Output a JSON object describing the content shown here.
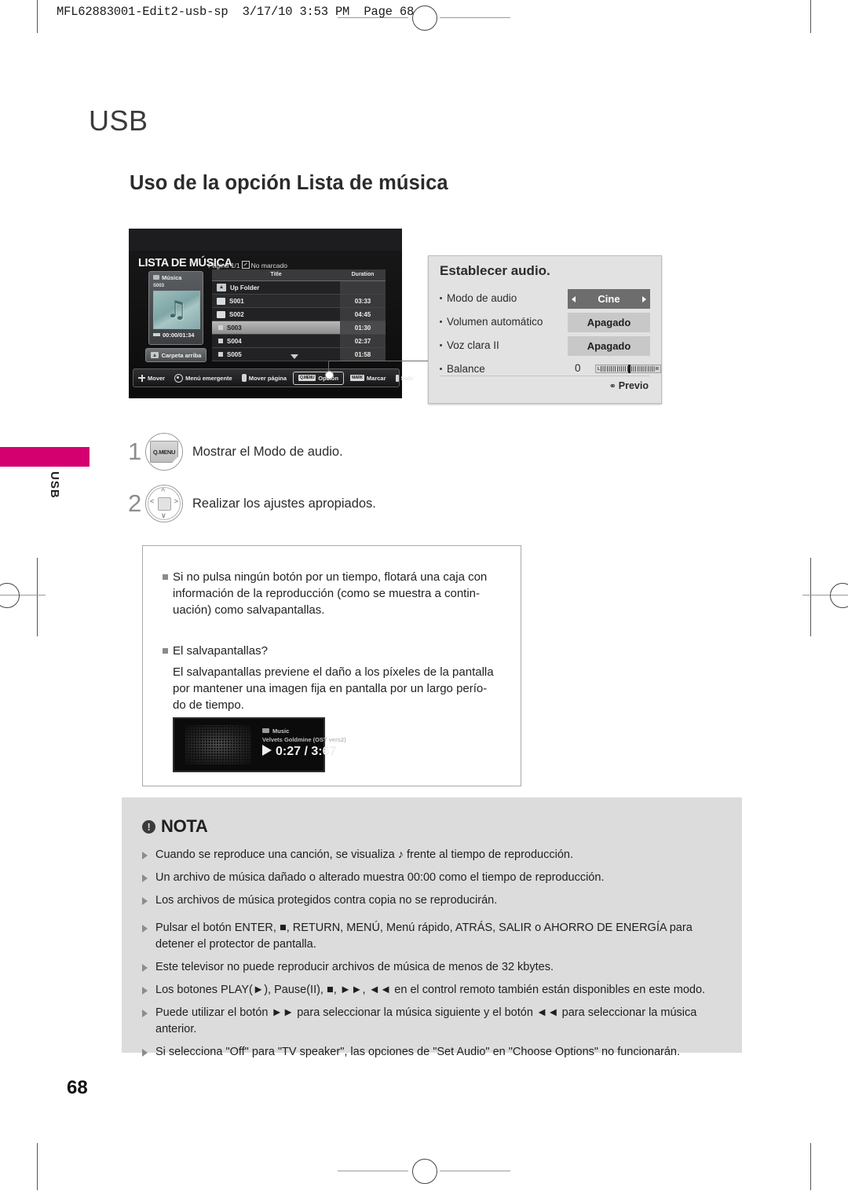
{
  "print_header": "MFL62883001-Edit2-usb-sp  3/17/10 3:53 PM  Page 68",
  "page_number": "68",
  "side_tab_label": "USB",
  "chapter_title": "USB",
  "section_title": "Uso de la opción Lista de música",
  "music_list_screen": {
    "title": "LISTA DE MÚSICA",
    "page_indicator": "Página 1/1",
    "mark_status": "No marcado",
    "preview": {
      "header": "Música",
      "file": "S003",
      "time": "00:00/01:34",
      "up_button": "Carpeta arriba"
    },
    "columns": {
      "title": "Title",
      "duration": "Duration"
    },
    "rows": [
      {
        "name": "Up Folder",
        "duration": "",
        "icon": "up-folder-icon",
        "selected": false
      },
      {
        "name": "S001",
        "duration": "03:33",
        "icon": "folder-icon",
        "selected": false
      },
      {
        "name": "S002",
        "duration": "04:45",
        "icon": "folder-icon",
        "selected": false
      },
      {
        "name": "S003",
        "duration": "01:30",
        "icon": "music-file-icon",
        "selected": true
      },
      {
        "name": "S004",
        "duration": "02:37",
        "icon": "music-file-icon",
        "selected": false
      },
      {
        "name": "S005",
        "duration": "01:58",
        "icon": "music-file-icon",
        "selected": false
      }
    ],
    "toolbar": [
      {
        "label": "Mover",
        "key": "",
        "icon": "dpad-icon"
      },
      {
        "label": "Menú emergente",
        "key": "",
        "icon": "wheel-icon"
      },
      {
        "label": "Mover página",
        "key": "",
        "icon": "page-icon"
      },
      {
        "label": "Opción",
        "key": "Q.MENU",
        "icon": ""
      },
      {
        "label": "Marcar",
        "key": "MARK",
        "icon": ""
      },
      {
        "label": "Salir",
        "key": "",
        "icon": "exit-icon"
      }
    ]
  },
  "audio_panel": {
    "title": "Establecer audio.",
    "rows": [
      {
        "label": "Modo de audio",
        "value": "Cine",
        "style": "dark",
        "arrows": true
      },
      {
        "label": "Volumen automático",
        "value": "Apagado",
        "style": "light",
        "arrows": false
      },
      {
        "label": "Voz clara II",
        "value": "Apagado",
        "style": "light",
        "arrows": false
      }
    ],
    "balance": {
      "label": "Balance",
      "value": "0",
      "left": "L",
      "right": "R"
    },
    "previous": "Previo"
  },
  "steps": [
    {
      "num": "1",
      "key_label": "Q.MENU",
      "text": "Mostrar el Modo de audio."
    },
    {
      "num": "2",
      "key_label": "navigation-pad",
      "text": "Realizar los ajustes apropiados."
    }
  ],
  "info_box": {
    "bullet1_l1": "Si no pulsa ningún botón por un tiempo, flotará una caja con",
    "bullet1_l2": "información de la reproducción (como se muestra a contin-",
    "bullet1_l3": "uación) como salvapantallas.",
    "bullet2": "El salvapantallas?",
    "para_l1": "El salvapantallas previene el daño a los píxeles de la pantalla",
    "para_l2": "por mantener una imagen fija en pantalla por un largo perío-",
    "para_l3": "do de tiempo.",
    "screensaver": {
      "label": "Music",
      "track": "Velvets Goldmine (OST vers2)",
      "time": "0:27 / 3:67"
    }
  },
  "nota": {
    "heading": "NOTA",
    "items": [
      "Cuando se reproduce una canción, se visualiza ♪ frente al tiempo de reproducción.",
      "Un archivo de música dañado o alterado muestra 00:00 como el tiempo de reproducción.",
      "Los archivos de música protegidos contra copia no se reproducirán.",
      "Pulsar el botón ENTER, ■, RETURN, MENÚ, Menú rápido, ATRÁS, SALIR o AHORRO DE ENERGÍA para detener el protector de pantalla.",
      "Este televisor no puede reproducir archivos de música de menos de 32 kbytes.",
      "Los botones PLAY(►), Pause(II), ■, ►►, ◄◄ en el control remoto también están disponibles en este modo.",
      "Puede utilizar el botón ►► para seleccionar la música siguiente y el botón ◄◄ para seleccionar la música anterior.",
      "Si selecciona \"Off\" para \"TV speaker\", las opciones de \"Set Audio\" en \"Choose Options\" no funcionarán."
    ]
  },
  "colors": {
    "accent_pink": "#d4006f",
    "nota_bg": "#dcdcdc",
    "panel_bg": "#e2e2e2"
  }
}
